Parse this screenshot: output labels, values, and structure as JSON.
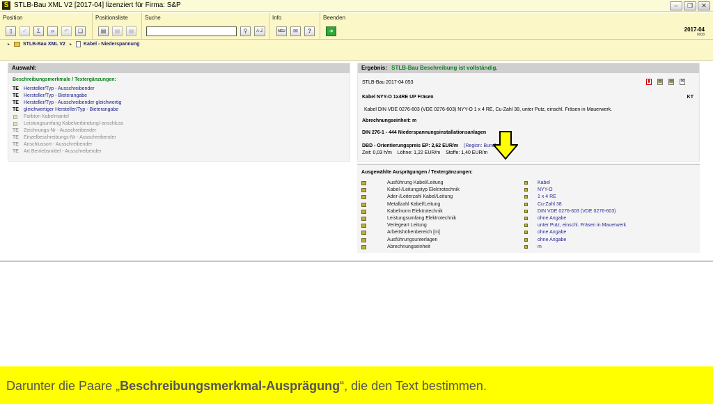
{
  "window": {
    "app_icon": "S",
    "title": "STLB-Bau XML V2 [2017-04] lizenziert für Firma: S&P",
    "controls": [
      "minimize-icon",
      "restore-icon",
      "close-icon"
    ]
  },
  "toolbar": {
    "groups": {
      "position": "Position",
      "positionsliste": "Positionsliste",
      "suche": "Suche",
      "info": "Info",
      "beenden": "Beenden"
    },
    "search_value": "",
    "search_az": "A-Z",
    "info_new": "NEU",
    "version": "2017-04",
    "build": "0008"
  },
  "breadcrumb": {
    "root": "STLB-Bau XML V2",
    "current": "Kabel - Niederspannung"
  },
  "auswahl": {
    "title": "Auswahl:",
    "subtitle": "Beschreibungsmerkmale / Textergänzungen:",
    "items": [
      {
        "tag": "TE",
        "label": "Hersteller/Typ - Ausschreibender",
        "state": "active"
      },
      {
        "tag": "TE",
        "label": "Hersteller/Typ - Bieterangabe",
        "state": "active"
      },
      {
        "tag": "TE",
        "label": "Hersteller/Typ - Ausschreibender gleichwertig",
        "state": "active"
      },
      {
        "tag": "TE",
        "label": "gleichwertiger Hersteller/Typ - Bieterangabe",
        "state": "active"
      },
      {
        "tag": "",
        "label": "Farbton Kabelmantel",
        "state": "muted"
      },
      {
        "tag": "",
        "label": "Leistungsumfang Kabelverbindung/-anschluss",
        "state": "muted"
      },
      {
        "tag": "TE",
        "label": "Zeichnungs-Nr - Ausschreibender",
        "state": "muted"
      },
      {
        "tag": "TE",
        "label": "Einzelbeschreibungs-Nr - Ausschreibender",
        "state": "muted"
      },
      {
        "tag": "TE",
        "label": "Anschlussort - Ausschreibender",
        "state": "muted"
      },
      {
        "tag": "TE",
        "label": "Art Betriebsmittel - Ausschreibender",
        "state": "muted"
      }
    ]
  },
  "ergebnis": {
    "label": "Ergebnis:",
    "status": "STLB-Bau Beschreibung ist vollständig.",
    "code": "STLB-Bau 2017-04 053",
    "short_text": "Kabel NYY-O 1x4RE UP Fräsen",
    "unit_code": "KT",
    "long_text": "Kabel DIN VDE 0276-603 (VDE 0276-603) NYY-O 1 x 4 RE, Cu-Zahl 38, unter Putz, einschl. Fräsen in Mauerwerk.",
    "abrechnung": "Abrechnungseinheit: m",
    "din": "DIN 276-1 - 444 Niederspannungsinstallationsanlagen",
    "dbd": "DBD - Orientierungspreis EP: 2,62 EUR/m",
    "dbd_link": "(Region: Bund)",
    "zeit": "Zeit: 0,03 h/m",
    "loehne": "Löhne: 1,22 EUR/m",
    "stoffe": "Stoffe: 1,40 EUR/m"
  },
  "auspraegungen": {
    "title": "Ausgewählte Ausprägungen / Textergänzungen:",
    "rows": [
      {
        "name": "Ausführung Kabel/Leitung",
        "value": "Kabel"
      },
      {
        "name": "Kabel-/Leitungstyp Elektrotechnik",
        "value": "NYY-O"
      },
      {
        "name": "Ader-/Leiterzahl Kabel/Leitung",
        "value": "1 x 4 RE"
      },
      {
        "name": "Metallzahl Kabel/Leitung",
        "value": "Cu-Zahl 38"
      },
      {
        "name": "Kabelnorm Elektrotechnik",
        "value": "DIN VDE 0276-603 (VDE 0276-603)"
      },
      {
        "name": "Leistungsumfang Elektrotechnik",
        "value": "ohne Angabe"
      },
      {
        "name": "Verlegeart Leitung",
        "value": "unter Putz, einschl. Fräsen in Mauerwerk"
      },
      {
        "name": "Arbeitshöhenbereich [m]",
        "value": "ohne Angabe"
      },
      {
        "name": "Ausführungsunterlagen",
        "value": "ohne Angabe"
      },
      {
        "name": "Abrechnungseinheit",
        "value": "m"
      }
    ]
  },
  "caption": {
    "before": "Darunter die Paare „",
    "bold": "Beschreibungsmerkmal-Ausprägung",
    "after": "“, die den Text bestimmen."
  },
  "colors": {
    "toolbar_bg": "#fbf7c6",
    "status_green": "#0a7f1a",
    "link_blue": "#2a2a9a",
    "caption_bg": "#ffff00",
    "arrow": "#ffff00"
  }
}
